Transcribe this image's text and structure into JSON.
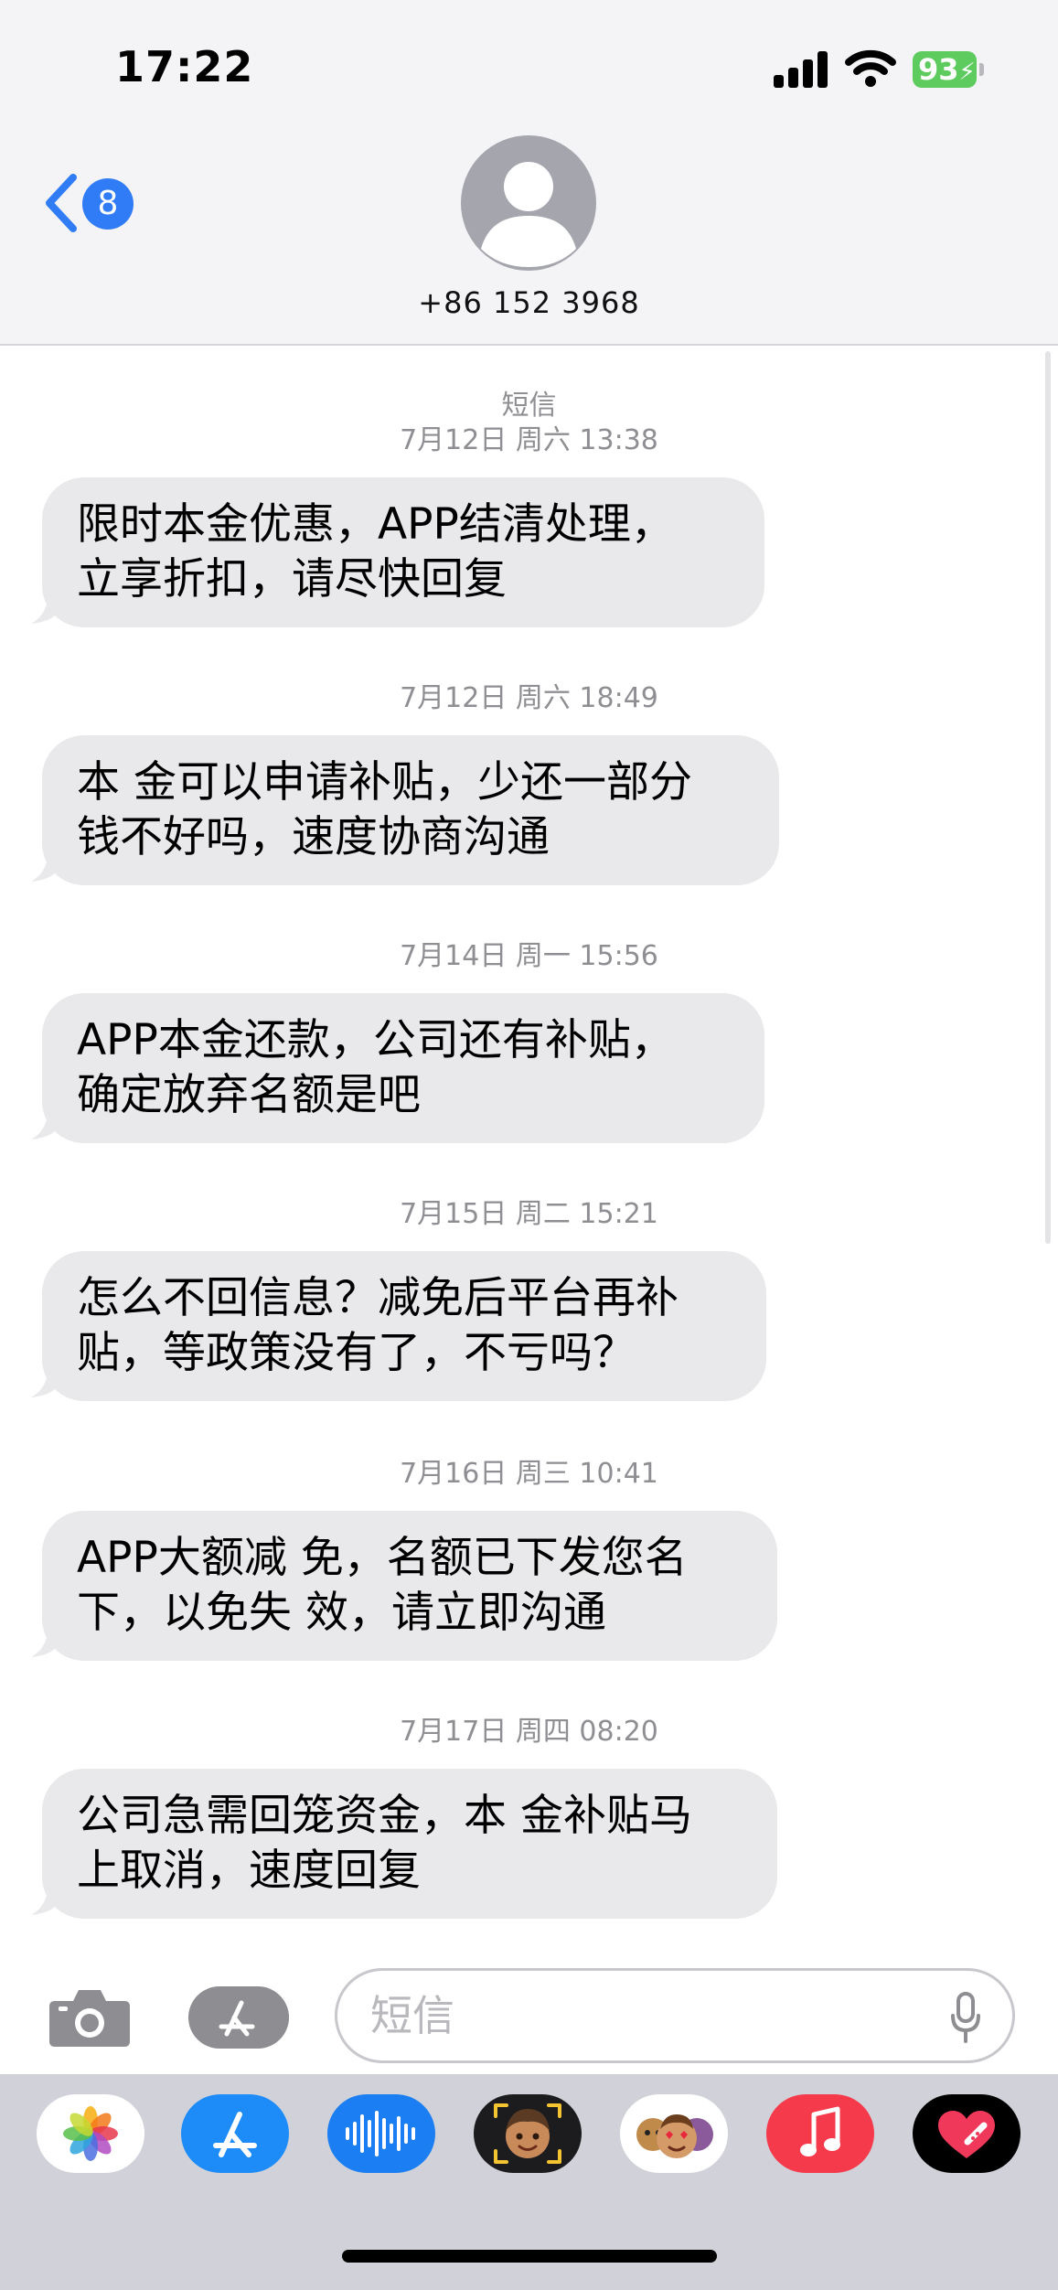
{
  "status_bar": {
    "time": "17:22",
    "battery": "93"
  },
  "header": {
    "back_badge": "8",
    "contact": "+86 152 3968",
    "icons": {
      "back": "chevron-left-icon",
      "avatar": "person-silhouette-icon"
    }
  },
  "thread": {
    "service_label": "短信",
    "messages": [
      {
        "timestamp": "7月12日 周六 13:38",
        "line1": "限时本金优惠，APP结清处理，",
        "line2": "立享折扣，请尽快回复"
      },
      {
        "timestamp": "7月12日 周六 18:49",
        "line1": "本 金可以申请补贴，少还一部分",
        "line2": "钱不好吗，速度协商沟通"
      },
      {
        "timestamp": "7月14日 周一 15:56",
        "line1": "APP本金还款，公司还有补贴，",
        "line2": "确定放弃名额是吧"
      },
      {
        "timestamp": "7月15日 周二 15:21",
        "line1": "怎么不回信息？减免后平台再补",
        "line2": "贴，等政策没有了，不亏吗？"
      },
      {
        "timestamp": "7月16日 周三 10:41",
        "line1": "APP大额减 免，名额已下发您名",
        "line2": "下，以免失 效，请立即沟通"
      },
      {
        "timestamp": "7月17日 周四 08:20",
        "line1": "公司急需回笼资金，本 金补贴马",
        "line2": "上取消，速度回复"
      }
    ]
  },
  "input_bar": {
    "placeholder": "短信"
  },
  "app_strip": {
    "apps": [
      "photos-app-icon",
      "app-store-icon",
      "audio-message-icon",
      "memoji-icon",
      "animoji-stickers-icon",
      "music-app-icon",
      "digital-touch-icon"
    ]
  },
  "colors": {
    "bubble": "#e9e9eb",
    "timestamp": "#8e8e93",
    "accent_blue": "#2f7cf6",
    "battery_green": "#5ecb5f",
    "header_bg": "#f4f4f6",
    "app_strip_bg": "#d1d2d9"
  }
}
